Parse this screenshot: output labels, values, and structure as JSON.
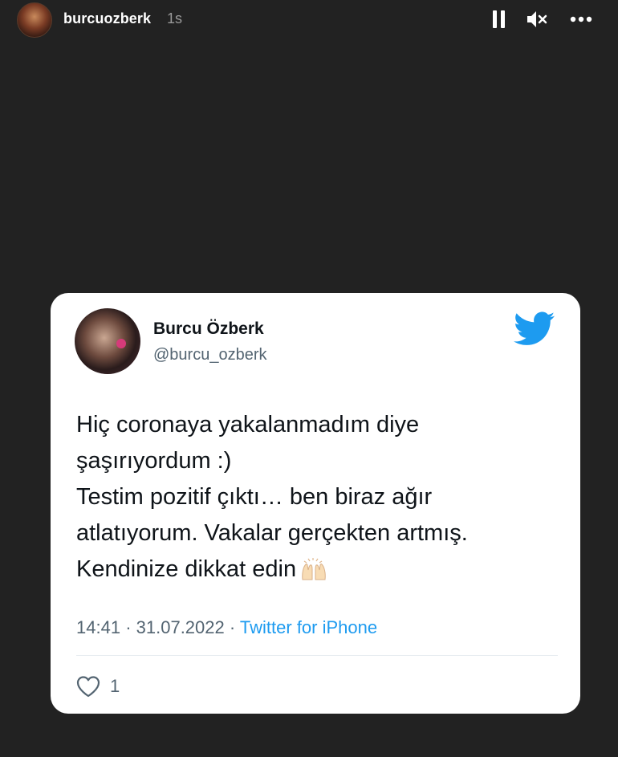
{
  "story": {
    "username": "burcuozberk",
    "time": "1s",
    "controls": {
      "pause_icon": "pause-icon",
      "mute_icon": "muted-speaker-icon",
      "more_icon": "more-horizontal-icon"
    }
  },
  "tweet": {
    "display_name": "Burcu Özberk",
    "handle": "@burcu_ozberk",
    "text_lines": [
      "Hiç coronaya yakalanmadım diye",
      "şaşırıyordum :)",
      "Testim pozitif çıktı… ben biraz ağır",
      "atlatıyorum. Vakalar gerçekten artmış.",
      "Kendinize dikkat edin"
    ],
    "emoji": "raising-hands-emoji",
    "time": "14:41",
    "separator": "·",
    "date": "31.07.2022",
    "source": "Twitter for iPhone",
    "like_count": "1",
    "brand_color": "#1d9bf0"
  }
}
